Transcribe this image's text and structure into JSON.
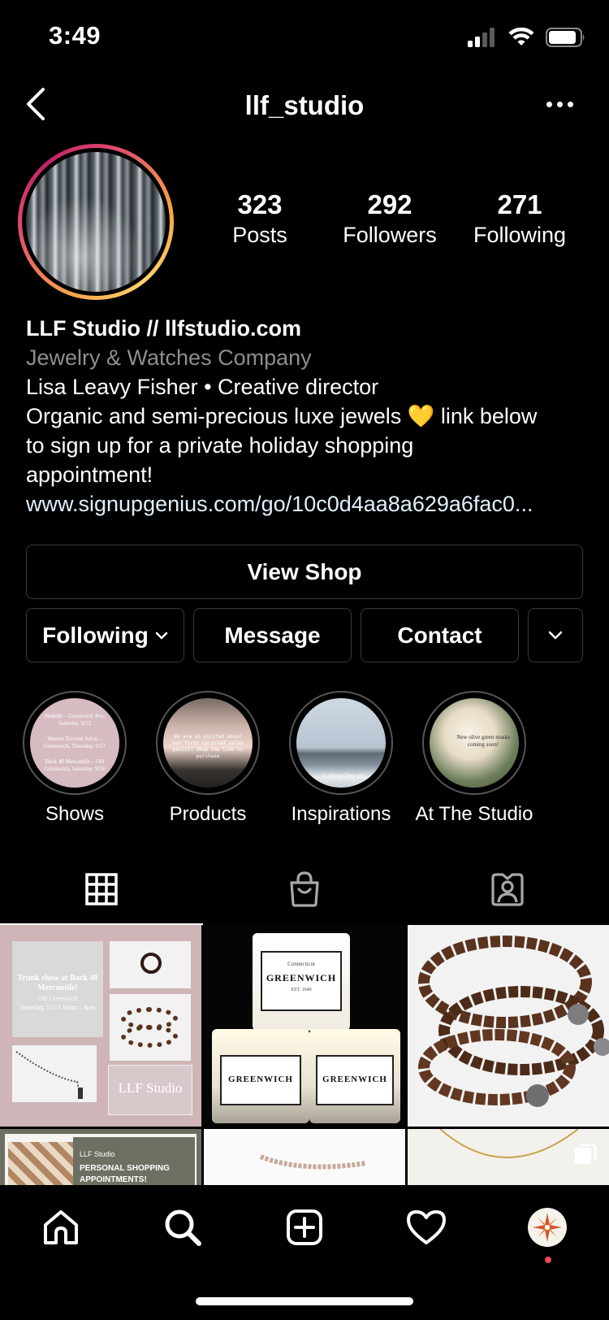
{
  "status_bar": {
    "time": "3:49"
  },
  "header": {
    "username": "llf_studio"
  },
  "stats": [
    {
      "key": "posts",
      "value": "323",
      "label": "Posts"
    },
    {
      "key": "followers",
      "value": "292",
      "label": "Followers"
    },
    {
      "key": "following",
      "value": "271",
      "label": "Following"
    }
  ],
  "bio": {
    "name": "LLF Studio // llfstudio.com",
    "category": "Jewelry & Watches Company",
    "line1": "Lisa Leavy Fisher • Creative director",
    "line2": "Organic and semi-precious luxe jewels 💛 link below",
    "line3": "to sign up for a private holiday shopping",
    "line4": "appointment!",
    "link": "www.signupgenius.com/go/10c0d4aa8a629a6fac0..."
  },
  "buttons": {
    "view_shop": "View Shop",
    "following": "Following",
    "message": "Message",
    "contact": "Contact"
  },
  "highlights": [
    {
      "label": "Shows"
    },
    {
      "label": "Products"
    },
    {
      "label": "Inspirations"
    },
    {
      "label": "At The Studio"
    }
  ],
  "highlight_text": {
    "shows_1": "Nobelle – Greenwich Ave, Saturday, 9/12",
    "shows_2": "Warren Tricomi Salon – Greenwich, Thursday, 9/17",
    "shows_3": "Back 40 Mercantile – Old Greenwich, Saturday, 9/26",
    "products": "We are so excited about our first upcycled sales pencil! Shop the link to purchase",
    "inspirations": "1 of our Day of...",
    "studio": "New olive green masks coming soon!"
  },
  "posts": {
    "trunk_title": "Trunk show at Back 40 Mercantile!",
    "trunk_place": "Old Greenwich",
    "trunk_date": "Saturday, 11/14 10am – 4pm",
    "trunk_brand": "LLF Studio",
    "candle_small": "Connecticut",
    "candle_name": "GREENWICH",
    "candle_est": "EST. 1640",
    "promo_brand": "LLF Studio",
    "promo_title": "PERSONAL SHOPPING APPOINTMENTS!"
  },
  "colors": {
    "background": "#000000",
    "secondary_text": "#8e8e8e",
    "button_border": "#3a3a3a",
    "story_ring_start": "#f9a447",
    "story_ring_end": "#c2226a",
    "notification_dot": "#ed4956"
  }
}
